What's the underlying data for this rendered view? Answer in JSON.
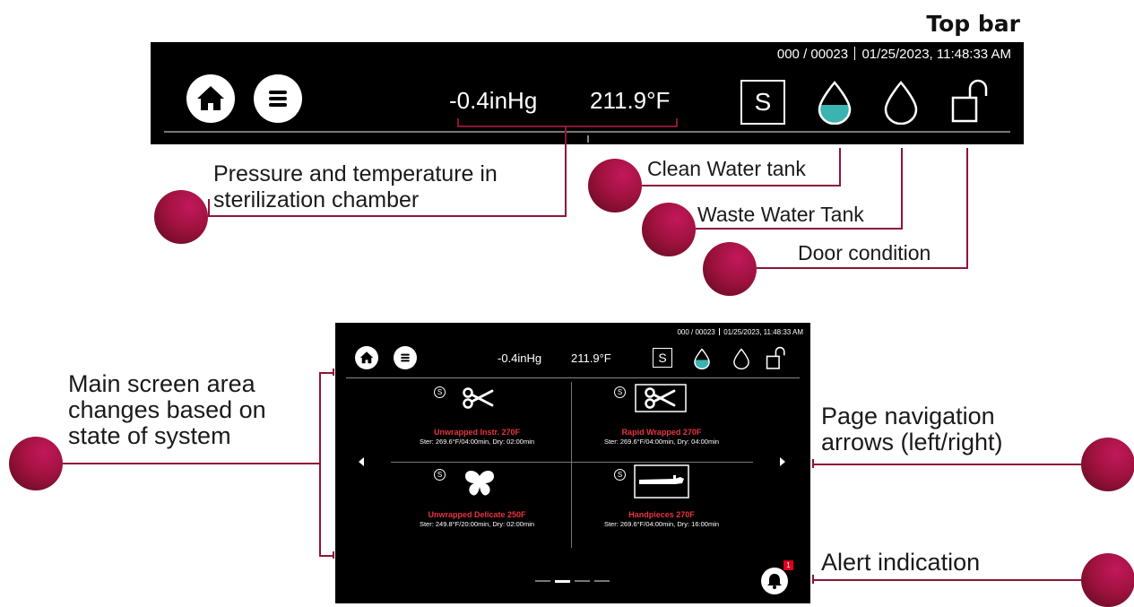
{
  "header": {
    "title": "Top bar"
  },
  "top_bar": {
    "counter": "000 / 00023",
    "datetime": "01/25/2023, 11:48:33 AM",
    "pressure": "-0.4inHg",
    "temperature": "211.9°F",
    "s_button": "S",
    "icons": [
      "home-icon",
      "menu-icon",
      "water-drop-filled-icon",
      "water-drop-empty-icon",
      "unlock-icon"
    ]
  },
  "callouts": {
    "pressure_temp": [
      "Pressure and temperature in",
      "sterilization chamber"
    ],
    "clean_water": "Clean Water tank",
    "waste_water": "Waste Water Tank",
    "door": "Door condition",
    "main_area": [
      "Main screen area",
      "changes based on",
      "state of system"
    ],
    "nav_arrows": [
      "Page navigation",
      "arrows (left/right)"
    ],
    "alert": "Alert indication"
  },
  "screen": {
    "counter": "000 / 00023",
    "datetime": "01/25/2023, 11:48:33 AM",
    "pressure": "-0.4inHg",
    "temperature": "211.9°F",
    "s_button": "S",
    "programs": [
      {
        "name": "Unwrapped Instr. 270F",
        "desc": "Ster: 269.6°F/04:00min, Dry: 02:00min",
        "icon": "scissors-icon",
        "badge": "S"
      },
      {
        "name": "Rapid Wrapped 270F",
        "desc": "Ster: 269.6°F/04:00min, Dry: 04:00min",
        "icon": "scissors-boxed-icon",
        "badge": "S"
      },
      {
        "name": "Unwrapped Delicate 250F",
        "desc": "Ster: 249.8°F/20:00min, Dry: 02:00min",
        "icon": "butterfly-icon",
        "badge": "S"
      },
      {
        "name": "Handpieces 270F",
        "desc": "Ster: 269.6°F/04:00min, Dry: 16:00min",
        "icon": "handpiece-icon",
        "badge": "S"
      }
    ],
    "alert_count": "1",
    "page_dots": 4,
    "active_page": 2
  },
  "colors": {
    "accent": "#8e1538",
    "program_name": "#e8343f",
    "water": "#3bb3b0",
    "screen_bg": "#000000"
  }
}
